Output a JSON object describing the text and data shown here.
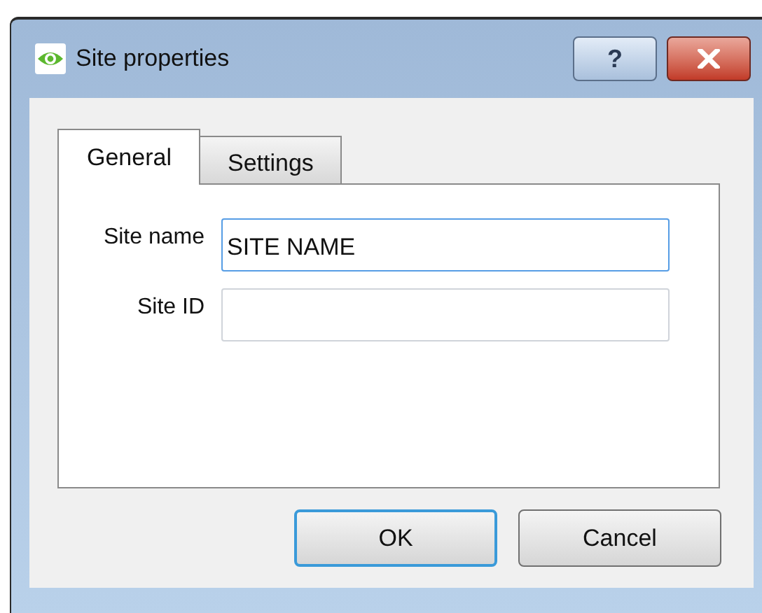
{
  "window": {
    "title": "Site properties",
    "controls": [
      {
        "kind": "help",
        "label": "?"
      },
      {
        "kind": "close"
      }
    ]
  },
  "tabs": [
    {
      "label": "General",
      "selected": true
    },
    {
      "label": "Settings",
      "selected": false
    }
  ],
  "fields": [
    {
      "label": "Site name",
      "value": "SITE NAME",
      "focused": true
    },
    {
      "label": "Site ID",
      "focused": false
    }
  ],
  "buttons": [
    {
      "label": "OK",
      "default": true
    },
    {
      "label": "Cancel",
      "default": false
    }
  ]
}
